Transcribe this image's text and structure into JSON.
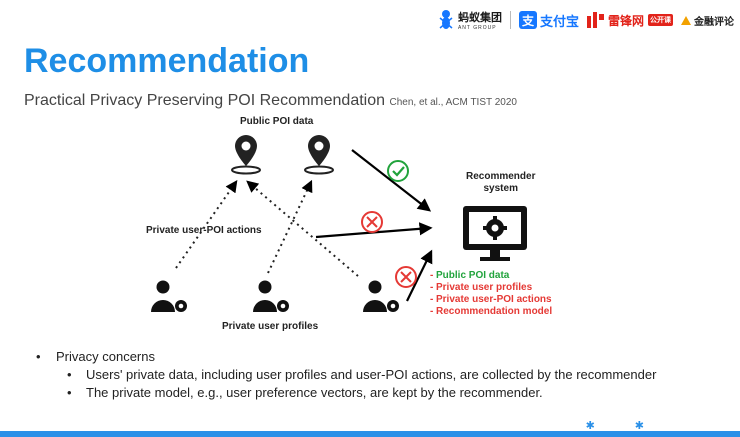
{
  "logos": {
    "ant": "蚂蚁集团",
    "ant_sub": "ANT GROUP",
    "alipay": "支付宝",
    "alipay_mark": "支",
    "leifeng": "雷锋网",
    "leifeng_badge": "公开课",
    "jinrong": "金融评论"
  },
  "slide": {
    "title": "Recommendation",
    "subtitle": "Practical Privacy Preserving POI Recommendation",
    "citation": "Chen, et al., ACM TIST 2020"
  },
  "diagram": {
    "public_label": "Public POI data",
    "actions_label": "Private user-POI actions",
    "profiles_label": "Private user profiles",
    "recommender_label_1": "Recommender",
    "recommender_label_2": "system",
    "legend": [
      {
        "text": "Public POI data",
        "color": "#21a33c"
      },
      {
        "text": "Private user profiles",
        "color": "#e53935"
      },
      {
        "text": "Private user-POI actions",
        "color": "#e53935"
      },
      {
        "text": "Recommendation model",
        "color": "#e53935"
      }
    ]
  },
  "bullets": {
    "main": "Privacy concerns",
    "sub1": "Users' private data, including user profiles and user-POI actions, are collected by the recommender",
    "sub2": "The private model, e.g., user preference vectors, are kept by the recommender."
  },
  "colors": {
    "title_blue": "#1e8ee6",
    "check_green": "#21a33c",
    "cross_red": "#e53935"
  },
  "icons": [
    "ant-logo-icon",
    "map-pin-icon",
    "user-gear-icon",
    "monitor-gear-icon",
    "check-circle-icon",
    "cross-circle-icon",
    "ant-mascot-icon"
  ]
}
